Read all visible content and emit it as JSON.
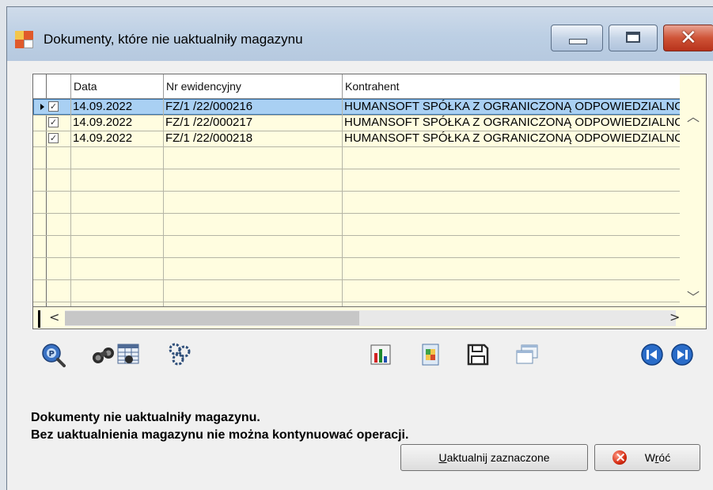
{
  "window": {
    "title": "Dokumenty, które nie uaktualniły magazynu"
  },
  "grid": {
    "columns": [
      "Data",
      "Nr ewidencyjny",
      "Kontrahent"
    ],
    "rows": [
      {
        "checked": true,
        "date": "14.09.2022",
        "nr": "FZ/1  /22/000216",
        "kontrahent": "HUMANSOFT SPÓŁKA Z OGRANICZONĄ ODPOWIEDZIALNOŚCIĄ",
        "selected": true
      },
      {
        "checked": true,
        "date": "14.09.2022",
        "nr": "FZ/1  /22/000217",
        "kontrahent": "HUMANSOFT SPÓŁKA Z OGRANICZONĄ ODPOWIEDZIALNOŚCIĄ",
        "selected": false
      },
      {
        "checked": true,
        "date": "14.09.2022",
        "nr": "FZ/1  /22/000218",
        "kontrahent": "HUMANSOFT SPÓŁKA Z OGRANICZONĄ ODPOWIEDZIALNOŚCIĄ",
        "selected": false
      }
    ],
    "scroll_up": "^",
    "scroll_down": "v",
    "scroll_left": "<",
    "scroll_right": ">"
  },
  "toolbar": {
    "icons": [
      "preview-magnifier-icon",
      "binoculars-icon",
      "grid-search-icon",
      "gears-icon",
      "chart-icon",
      "document-icon",
      "save-icon",
      "windows-icon",
      "first-record-icon",
      "last-record-icon"
    ]
  },
  "message": {
    "line1": "Dokumenty nie uaktualniły magazynu.",
    "line2": "Bez uaktualnienia magazynu nie można kontynuować operacji."
  },
  "buttons": {
    "update_mnemonic": "U",
    "update_rest": "aktualnij zaznaczone",
    "back_prefix": "W",
    "back_mnemonic": "r",
    "back_rest": "óć"
  },
  "colors": {
    "row_background": "#fffde0",
    "selected_row": "#a9d0f3",
    "title_bar": "#bccfe4",
    "close_button": "#cf5437"
  }
}
